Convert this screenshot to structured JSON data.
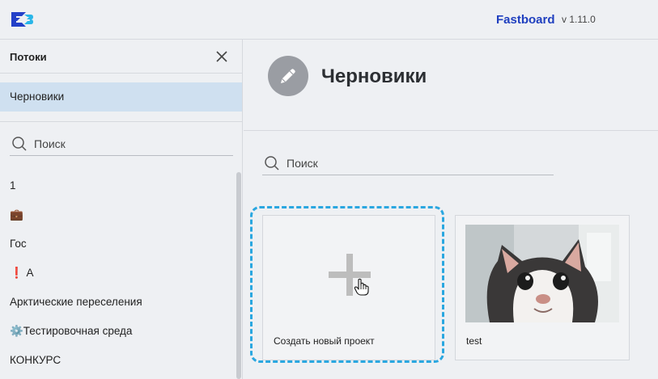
{
  "app": {
    "brand": "Fastboard",
    "version": "v 1.11.0",
    "accent_color": "#1f3fbf"
  },
  "sidebar": {
    "title": "Потоки",
    "drafts_label": "Черновики",
    "search_placeholder": "Поиск",
    "items": [
      {
        "label": "1"
      },
      {
        "label": "💼"
      },
      {
        "label": "Гос"
      },
      {
        "label": "❗ А"
      },
      {
        "label": "Арктические переселения"
      },
      {
        "label": "⚙️Тестировочная среда"
      },
      {
        "label": "КОНКУРС"
      }
    ]
  },
  "main": {
    "title": "Черновики",
    "title_icon": "pencil-icon",
    "search_placeholder": "Поиск",
    "cards": [
      {
        "label": "Создать новый проект",
        "icon": "plus-icon"
      },
      {
        "label": "test"
      }
    ],
    "highlight_color": "#2aa7e0"
  }
}
